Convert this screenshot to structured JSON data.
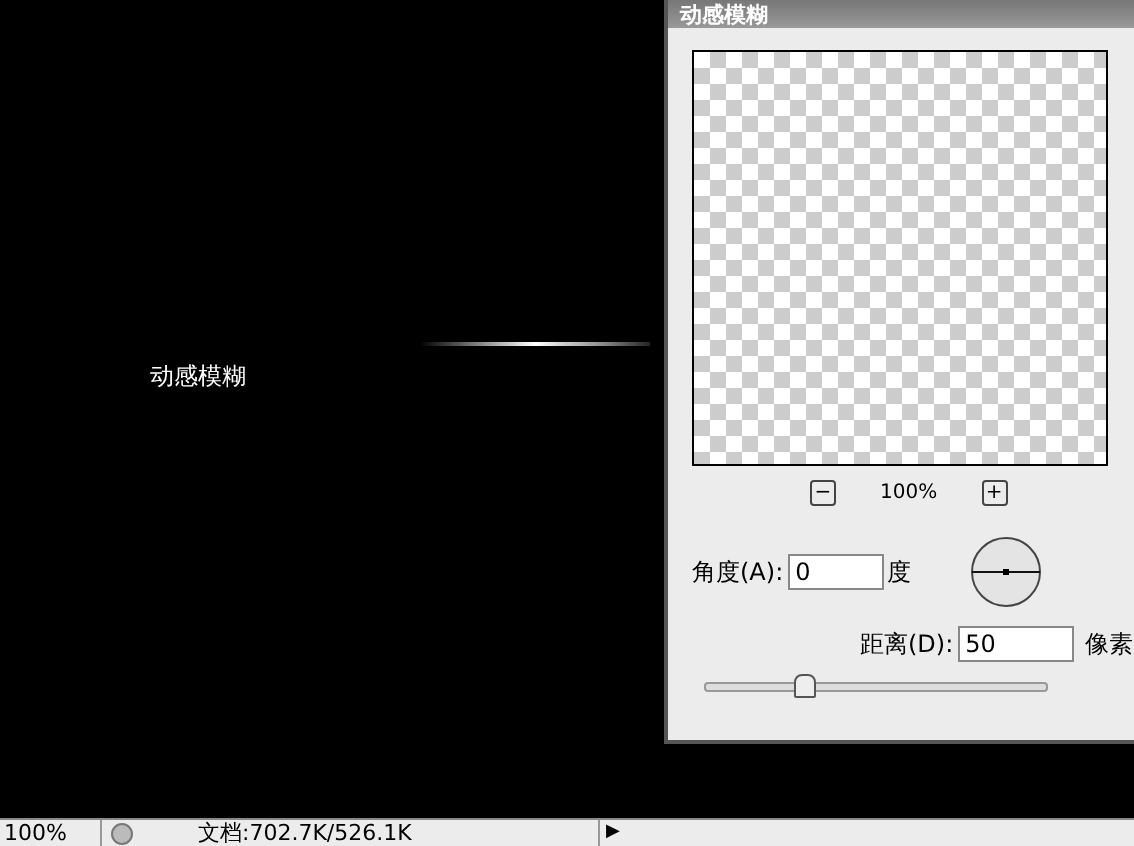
{
  "canvas": {
    "caption": "动感模糊"
  },
  "dialog": {
    "title": "动感模糊",
    "zoom": {
      "minus": "−",
      "value": "100%",
      "plus": "+"
    },
    "angle": {
      "label": "角度(A):",
      "value": "0",
      "unit": "度"
    },
    "distance": {
      "label": "距离(D):",
      "value": "50",
      "unit": "像素",
      "level": 0.28
    }
  },
  "status_bar": {
    "zoom": "100%",
    "doc": "文档:702.7K/526.1K",
    "arrow": "▶"
  }
}
